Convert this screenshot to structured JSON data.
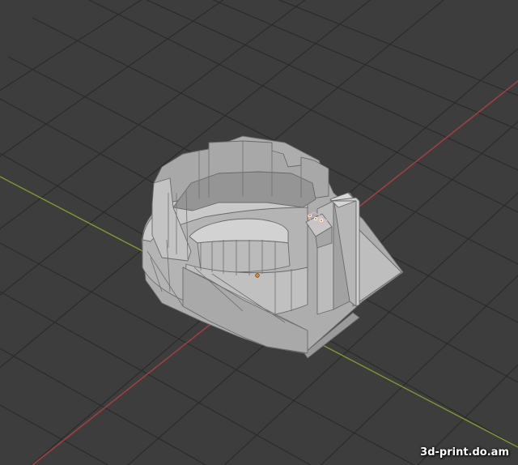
{
  "viewport": {
    "background_color": "#3d3d3d",
    "grid_line_color": "#2b2b2b",
    "x_axis_color": "#a33d44",
    "y_axis_color": "#7d9a2f",
    "model_color": "#b9b9b9",
    "object_origin_color": "#e08a2a"
  },
  "watermark": {
    "text": "3d-print.do.am"
  }
}
